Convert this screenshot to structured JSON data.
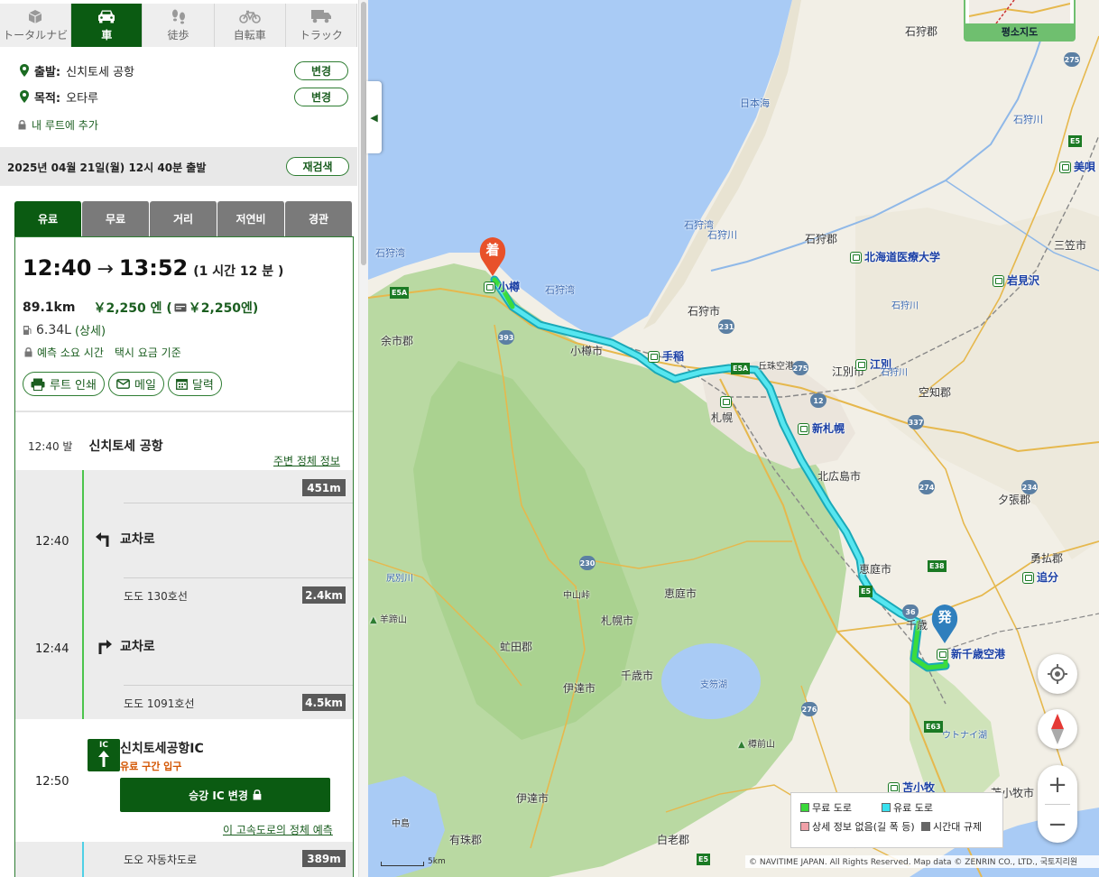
{
  "modes": [
    {
      "label": "トータルナビ",
      "icon": "cube-icon"
    },
    {
      "label": "車",
      "icon": "car-icon"
    },
    {
      "label": "徒歩",
      "icon": "footprints-icon"
    },
    {
      "label": "自転車",
      "icon": "bicycle-icon"
    },
    {
      "label": "トラック",
      "icon": "truck-icon"
    }
  ],
  "origin": {
    "label": "출발:",
    "value": "신치토세 공항",
    "change": "변경"
  },
  "destination": {
    "label": "목적:",
    "value": "오타루",
    "change": "변경"
  },
  "my_route": "내 루트에 추가",
  "date": {
    "text": "2025년 04월 21일(월) 12시 40분 출발",
    "research": "재검색"
  },
  "tabs": [
    "유료",
    "무료",
    "거리",
    "저연비",
    "경관"
  ],
  "summary": {
    "depart": "12:40",
    "arrow": "→",
    "arrive": "13:52",
    "duration": "(1 시간 12 분 )",
    "distance": "89.1km",
    "fee": "￥2,250 엔 (",
    "etc_fee": "￥2,250엔)",
    "fuel": "6.34L",
    "fuel_detail": "(상세)",
    "note1": "예측 소요 시간",
    "note2": "택시 요금 기준"
  },
  "actions": {
    "print": "루트 인쇄",
    "mail": "메일",
    "calendar": "달력"
  },
  "start": {
    "time": "12:40 발",
    "name": "신치토세 공항",
    "jam": "주변 정체 정보"
  },
  "steps": [
    {
      "dist_before": "451m",
      "time": "12:40",
      "turn": "교차로",
      "dir": "left",
      "road": "도도 130호선",
      "dist_after": "2.4km"
    },
    {
      "time": "12:44",
      "turn": "교차로",
      "dir": "right",
      "road": "도도 1091호선",
      "dist_after": "4.5km"
    }
  ],
  "ic": {
    "badge": "IC",
    "time": "12:50",
    "name": "신치토세공항IC",
    "sub": "유료 구간 입구",
    "button": "승강 IC 변경",
    "forecast": "이 고속도로의 정체 예측",
    "next_road": "도오 자동차도로",
    "next_dist": "389m"
  },
  "map": {
    "mini_label": "평소지도",
    "legend": {
      "free": "무료 도로",
      "toll": "유료 도로",
      "nodata": "상세 정보 없음(길 폭 등)",
      "time": "시간대 규제",
      "colors": {
        "free": "#39d839",
        "toll": "#39e1ef",
        "nodata": "#f0a0a8",
        "time": "#666666"
      }
    },
    "copyright": "© NAVITIME JAPAN. All Rights Reserved. Map data © ZENRIN CO., LTD., 국토지리원",
    "scale": "5km",
    "marker_start": "発",
    "marker_end": "着",
    "labels": {
      "ishikari_gun_top": "石狩郡",
      "ishikarigawa_1": "石狩川",
      "ishikarigawa_2": "石狩川",
      "ishikarigawa_3": "石狩川",
      "ishikarigawa_4": "石狩川",
      "nihonkai": "日本海",
      "bibai": "美唄",
      "ishikariwan_1": "石狩湾",
      "ishikariwan_2": "石狩湾",
      "ishikariwan_3": "石狩湾",
      "ishikari_gun": "石狩郡",
      "mikasa": "三笠市",
      "hokkaido_iryo": "北海道医療大学",
      "iwamizawa": "岩見沢",
      "otaru": "小樽",
      "ishikari_shi": "石狩市",
      "yoichi": "余市郡",
      "otaru_shi": "小樽市",
      "teine": "手稲",
      "okadama": "丘珠空港",
      "ebetsu_shi": "江別市",
      "ebetsu": "江別",
      "sapporo": "札幌",
      "sorachi": "空知郡",
      "shin_sapporo": "新札幌",
      "kitahiroshima": "北広島市",
      "yubari": "夕張郡",
      "yuni": "勇払郡",
      "shiribetsu": "尻別川",
      "eniwa": "恵庭市",
      "oiwake": "追分",
      "nakayama": "中山峠",
      "eniwa2": "恵庭市",
      "chitose": "千歳",
      "shin_chitose": "新千歳空港",
      "yotei": "羊蹄山",
      "sapporo_shi": "札幌市",
      "abuta": "虻田郡",
      "shikotsu": "支笏湖",
      "date_shi": "伊達市",
      "chitose_shi": "千歳市",
      "utonai": "ウトナイ湖",
      "tarumae": "樽前山",
      "tomakomai": "苫小牧",
      "tomakomai_shi": "苫小牧市",
      "date_shi2": "伊達市",
      "nakajima": "中島",
      "usu": "有珠郡",
      "shiraoi": "白老郡"
    },
    "routes": {
      "r275a": "275",
      "r275b": "275",
      "r231": "231",
      "r393": "393",
      "r12": "12",
      "r337": "337",
      "r274": "274",
      "r234": "234",
      "r230": "230",
      "r36": "36",
      "r276": "276",
      "e5a_1": "E5A",
      "e5a_2": "E5A",
      "e5_1": "E5",
      "e5_2": "E5",
      "e5_3": "E5",
      "e38": "E38",
      "e63": "E63"
    }
  }
}
